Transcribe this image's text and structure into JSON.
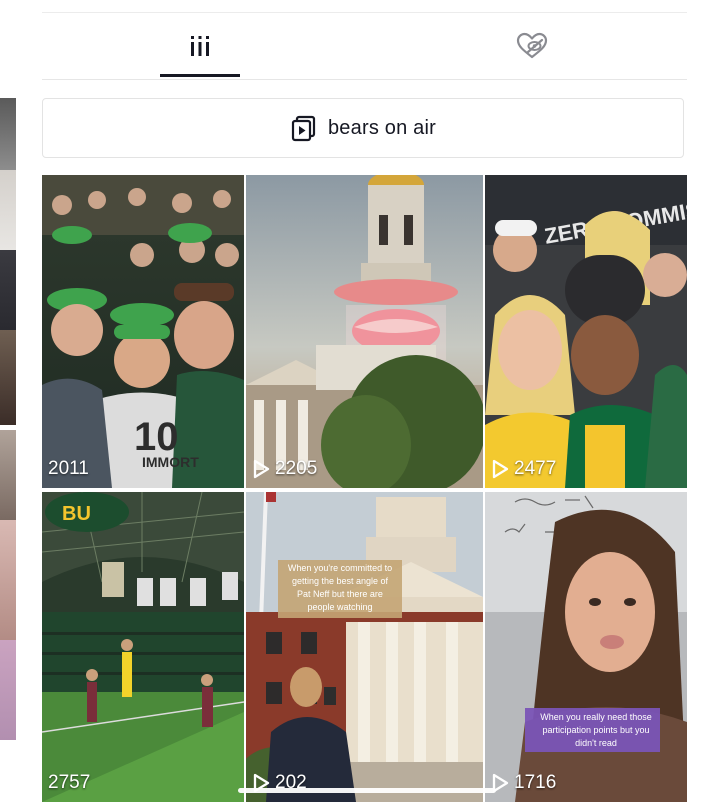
{
  "tabs": [
    {
      "label": "videos",
      "icon": "grid-icon",
      "active": true
    },
    {
      "label": "liked",
      "icon": "hidden-heart-icon",
      "active": false
    }
  ],
  "playlist": {
    "label": "bears on air",
    "icon": "playlist-icon"
  },
  "videos": [
    {
      "views": "2011",
      "pinned": false,
      "show_play": false
    },
    {
      "views": "2205",
      "show_play": true
    },
    {
      "views": "2477",
      "show_play": true
    },
    {
      "views": "2757",
      "show_play": false
    },
    {
      "views": "202",
      "show_play": true,
      "caption": "When you're committed to getting the best angle of Pat Neff but there are people watching"
    },
    {
      "views": "1716",
      "show_play": true,
      "caption": "When you really need those participation points but you didn't read"
    }
  ],
  "colors": {
    "text": "#161823",
    "divider": "#e6e6e6",
    "baylor_green": "#154734",
    "baylor_gold": "#ffb81c"
  }
}
